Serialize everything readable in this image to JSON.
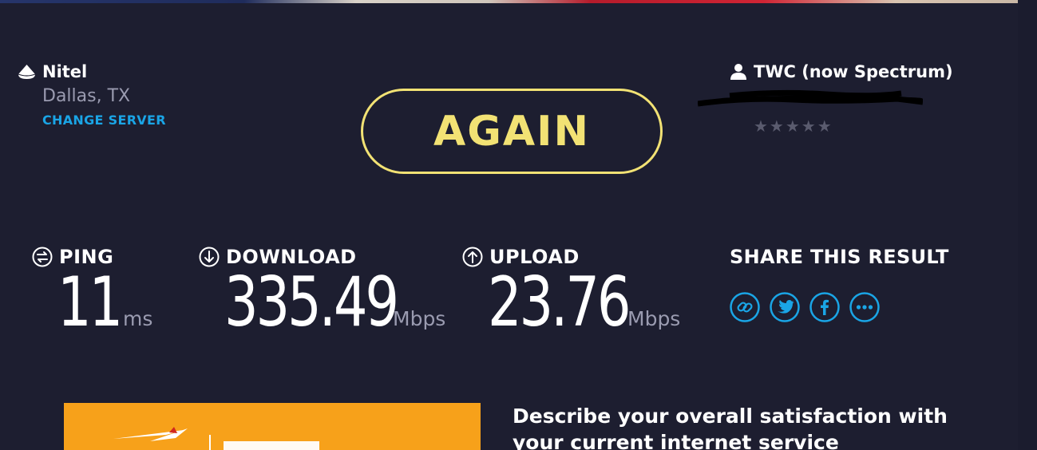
{
  "server": {
    "name": "Nitel",
    "location": "Dallas, TX",
    "change_label": "CHANGE SERVER"
  },
  "again_button": {
    "label": "AGAIN"
  },
  "isp": {
    "name": "TWC (now Spectrum)",
    "rating_stars": "★★★★★",
    "rating_filled": 0,
    "rating_max": 5
  },
  "metrics": {
    "ping": {
      "label": "PING",
      "value": "11",
      "unit": "ms"
    },
    "download": {
      "label": "DOWNLOAD",
      "value": "335.49",
      "unit": "Mbps"
    },
    "upload": {
      "label": "UPLOAD",
      "value": "23.76",
      "unit": "Mbps"
    }
  },
  "share": {
    "title": "SHARE THIS RESULT",
    "icons": [
      "link-icon",
      "twitter-icon",
      "facebook-icon",
      "more-icon"
    ]
  },
  "survey": {
    "question": "Describe your overall satisfaction with your current internet service"
  },
  "colors": {
    "background": "#1d1e30",
    "accent_yellow": "#f2e274",
    "link_blue": "#1aa5e6",
    "muted_text": "#9a9bb0",
    "ad_orange": "#f7a11a"
  }
}
